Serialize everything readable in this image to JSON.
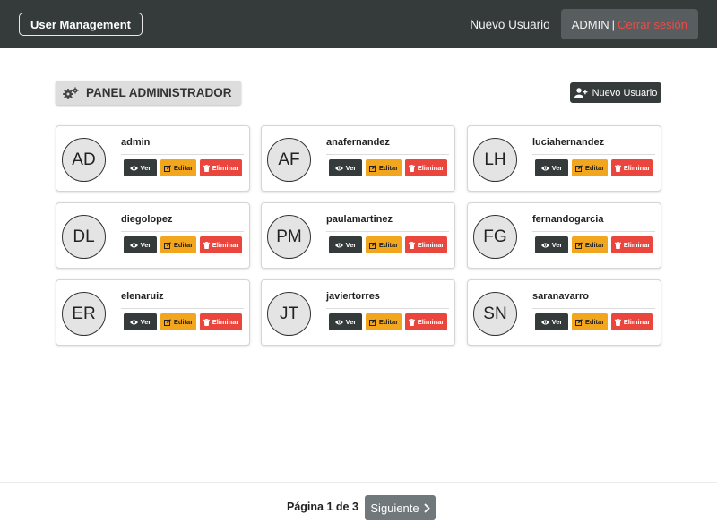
{
  "navbar": {
    "brand": "User Management",
    "new_user_link": "Nuevo Usuario",
    "current_user": "ADMIN",
    "separator": "|",
    "logout": "Cerrar sesión"
  },
  "panel": {
    "title": "PANEL ADMINISTRADOR",
    "title_icon": "gears-icon",
    "new_user_button": "Nuevo Usuario",
    "new_user_icon": "user-plus-icon"
  },
  "actions": {
    "view_label": "Ver",
    "edit_label": "Editar",
    "delete_label": "Eliminar"
  },
  "users": [
    {
      "initials": "AD",
      "username": "admin"
    },
    {
      "initials": "AF",
      "username": "anafernandez"
    },
    {
      "initials": "LH",
      "username": "luciahernandez"
    },
    {
      "initials": "DL",
      "username": "diegolopez"
    },
    {
      "initials": "PM",
      "username": "paulamartinez"
    },
    {
      "initials": "FG",
      "username": "fernandogarcia"
    },
    {
      "initials": "ER",
      "username": "elenaruiz"
    },
    {
      "initials": "JT",
      "username": "javiertorres"
    },
    {
      "initials": "SN",
      "username": "saranavarro"
    }
  ],
  "pagination": {
    "info": "Página 1 de 3",
    "next_label": "Siguiente"
  },
  "colors": {
    "navbar": "#353b3a",
    "edit": "#f2a61d",
    "delete": "#ea463d",
    "logout": "#ef4a45"
  }
}
